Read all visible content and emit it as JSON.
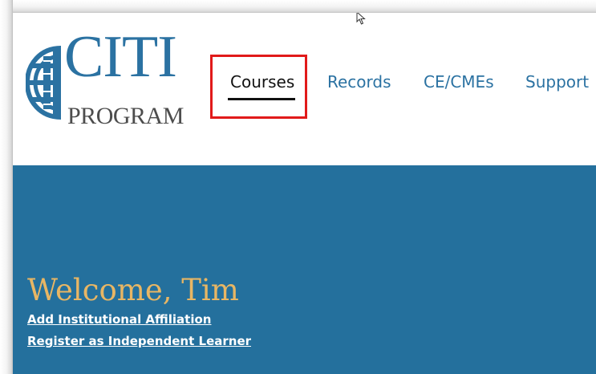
{
  "logo": {
    "brand": "CITI",
    "sub": "PROGRAM"
  },
  "nav": {
    "items": [
      {
        "label": "Courses",
        "active": true
      },
      {
        "label": "Records",
        "active": false
      },
      {
        "label": "CE/CMEs",
        "active": false
      },
      {
        "label": "Support",
        "active": false
      }
    ]
  },
  "banner": {
    "welcome": "Welcome, Tim",
    "links": [
      {
        "label": "Add Institutional Affiliation"
      },
      {
        "label": "Register as Independent Learner"
      }
    ]
  },
  "colors": {
    "brand_blue": "#2b72a2",
    "banner_blue": "#24709d",
    "welcome_gold": "#e8b664",
    "highlight_red": "#e11a1a"
  }
}
